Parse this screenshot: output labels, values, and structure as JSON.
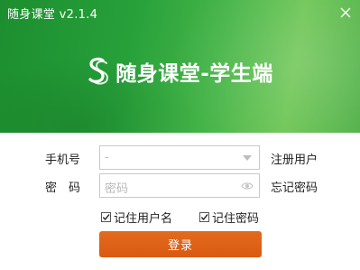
{
  "window": {
    "title": "随身课堂 v2.1.4",
    "close_icon": "close-icon"
  },
  "brand": {
    "logo_icon": "ss-logo-icon",
    "name": "随身课堂-学生端"
  },
  "form": {
    "phone_label": "手机号",
    "phone_placeholder": "-",
    "password_label": "密码",
    "password_placeholder": "密码",
    "register_link": "注册用户",
    "forgot_link": "忘记密码",
    "remember_user": {
      "label": "记住用户名",
      "checked": true
    },
    "remember_password": {
      "label": "记住密码",
      "checked": true
    },
    "login_button": "登录"
  },
  "colors": {
    "header_green": "#27a03a",
    "login_orange": "#e0621a"
  }
}
